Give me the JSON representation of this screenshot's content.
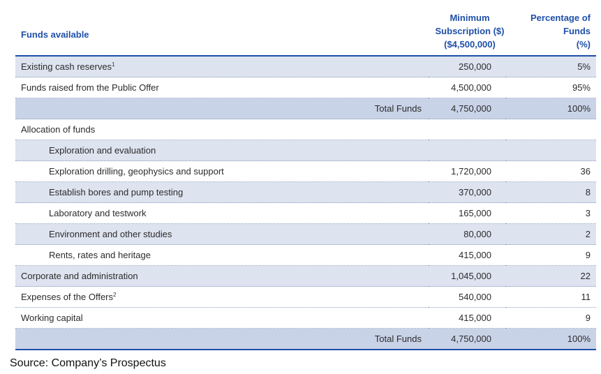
{
  "header": {
    "funds_available": "Funds available",
    "min_sub_line1": "Minimum",
    "min_sub_line2": "Subscription ($)",
    "min_sub_line3": "($4,500,000)",
    "pct_line1": "Percentage of",
    "pct_line2": "Funds",
    "pct_line3": "(%)"
  },
  "rows": [
    {
      "label": "Existing cash reserves",
      "sup": "1",
      "amount": "250,000",
      "pct": "5%"
    },
    {
      "label": "Funds raised from the Public Offer",
      "sup": "",
      "amount": "4,500,000",
      "pct": "95%"
    },
    {
      "label": "Total Funds",
      "sup": "",
      "amount": "4,750,000",
      "pct": "100%"
    },
    {
      "label": "Allocation of funds",
      "sup": "",
      "amount": "",
      "pct": ""
    },
    {
      "label": "Exploration and evaluation",
      "sup": "",
      "amount": "",
      "pct": ""
    },
    {
      "label": "Exploration drilling, geophysics and support",
      "sup": "",
      "amount": "1,720,000",
      "pct": "36"
    },
    {
      "label": "Establish bores and pump testing",
      "sup": "",
      "amount": "370,000",
      "pct": "8"
    },
    {
      "label": "Laboratory and testwork",
      "sup": "",
      "amount": "165,000",
      "pct": "3"
    },
    {
      "label": "Environment and other studies",
      "sup": "",
      "amount": "80,000",
      "pct": "2"
    },
    {
      "label": "Rents, rates and heritage",
      "sup": "",
      "amount": "415,000",
      "pct": "9"
    },
    {
      "label": "Corporate and administration",
      "sup": "",
      "amount": "1,045,000",
      "pct": "22"
    },
    {
      "label": "Expenses of the Offers",
      "sup": "2",
      "amount": "540,000",
      "pct": "11"
    },
    {
      "label": "Working capital",
      "sup": "",
      "amount": "415,000",
      "pct": "9"
    },
    {
      "label": "Total Funds",
      "sup": "",
      "amount": "4,750,000",
      "pct": "100%"
    }
  ],
  "source": "Source: Company’s Prospectus"
}
